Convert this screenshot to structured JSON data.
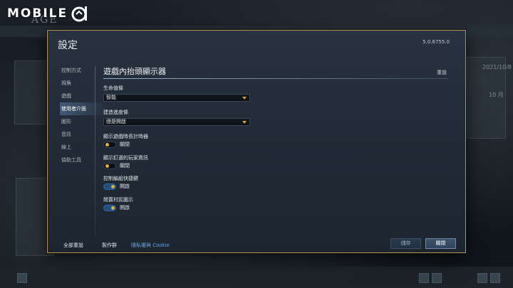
{
  "watermark": {
    "text": "MOBILE"
  },
  "background": {
    "game_title": "AGE",
    "date_text": "2021/10/8",
    "side_text": "10 月"
  },
  "dialog": {
    "title": "設定",
    "version": "5.0.6755.0"
  },
  "nav": {
    "items": [
      {
        "label": "控制方式",
        "active": false
      },
      {
        "label": "視角",
        "active": false
      },
      {
        "label": "遊戲",
        "active": false
      },
      {
        "label": "使用者介面",
        "active": true
      },
      {
        "label": "圖形",
        "active": false
      },
      {
        "label": "音訊",
        "active": false
      },
      {
        "label": "線上",
        "active": false
      },
      {
        "label": "協助工具",
        "active": false
      }
    ]
  },
  "section": {
    "title": "遊戲內抬頭顯示器",
    "reset_label": "重設"
  },
  "settings": {
    "health_bar": {
      "label": "生命值條",
      "value": "智能"
    },
    "build_progress": {
      "label": "建造進度條",
      "value": "總是開啟"
    },
    "game_timer": {
      "label": "顯示遊戲時長計時器",
      "state": "關閉",
      "on": false
    },
    "pinned_player": {
      "label": "顯示釘選的玩家資訊",
      "state": "關閉",
      "on": false
    },
    "control_group_hotkeys": {
      "label": "控制編組快捷鍵",
      "state": "開啟",
      "on": true
    },
    "idle_villager": {
      "label": "閒置村民圖示",
      "state": "開啟",
      "on": true
    }
  },
  "footer": {
    "reset_all": "全部重設",
    "credits": "製作群",
    "privacy": "隱私權與 Cookie",
    "save": "儲存",
    "close": "關閉"
  },
  "colors": {
    "accent_gold": "#d7a431",
    "toggle_on": "#1f4f83",
    "dialog_border": "#b8964e",
    "privacy_link": "#6ea3dc"
  }
}
